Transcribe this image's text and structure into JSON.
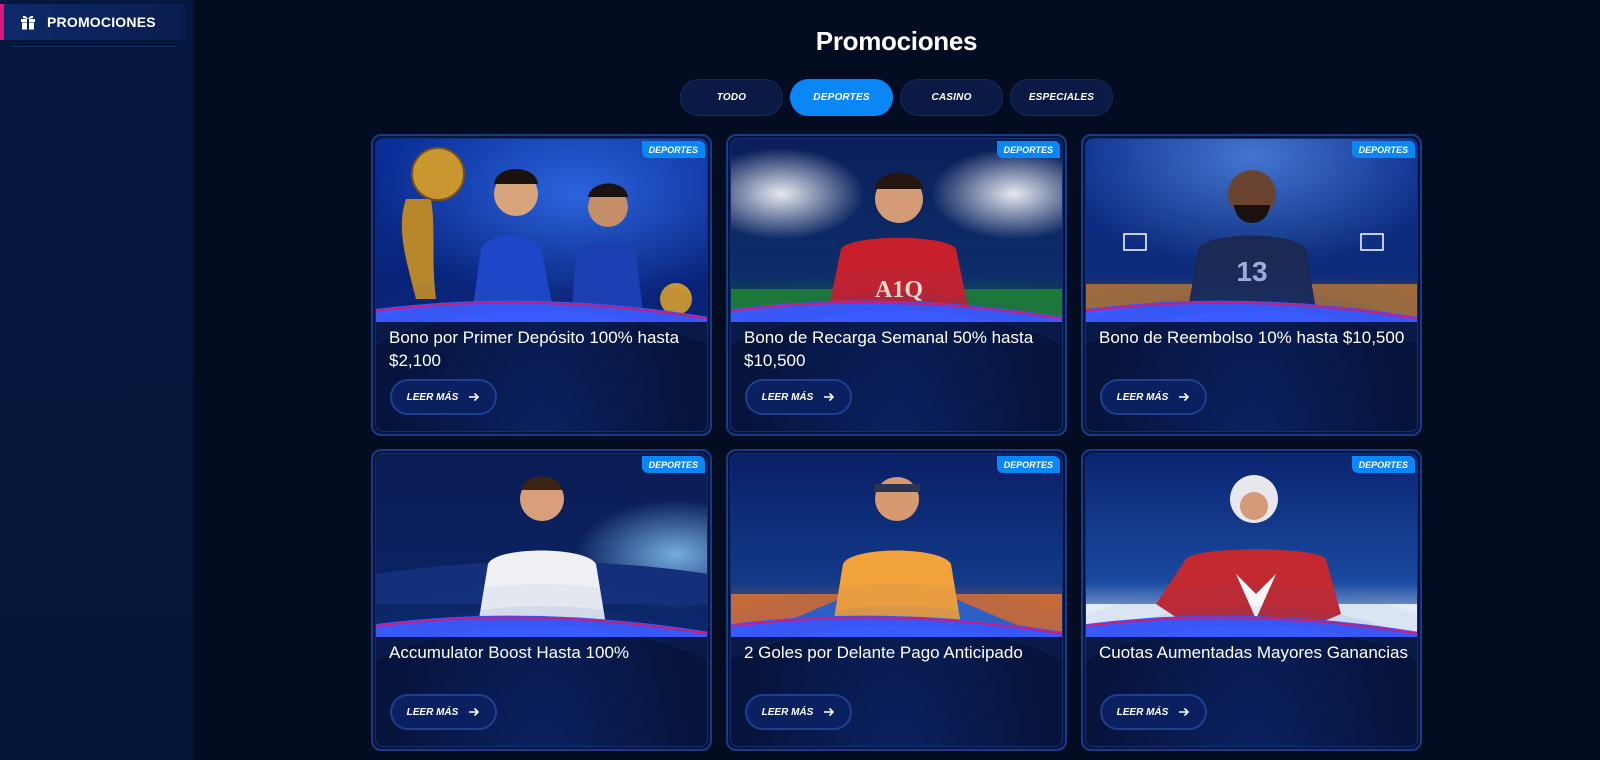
{
  "sidebar": {
    "items": [
      {
        "label": "PROMOCIONES",
        "icon": "gift-icon"
      }
    ]
  },
  "main": {
    "title": "Promociones",
    "tabs": [
      {
        "label": "TODO",
        "active": false
      },
      {
        "label": "DEPORTES",
        "active": true
      },
      {
        "label": "CASINO",
        "active": false
      },
      {
        "label": "ESPECIALES",
        "active": false
      }
    ],
    "cards": [
      {
        "badge": "DEPORTES",
        "title": "Bono por Primer Depósito 100% hasta $2,100",
        "button": "LEER MÁS",
        "image": "soccer-trophy-image"
      },
      {
        "badge": "DEPORTES",
        "title": "Bono de Recarga Semanal 50% hasta $10,500",
        "button": "LEER MÁS",
        "image": "soccer-goalkeeper-image"
      },
      {
        "badge": "DEPORTES",
        "title": "Bono de Reembolso 10% hasta $10,500",
        "button": "LEER MÁS",
        "image": "basketball-player-image"
      },
      {
        "badge": "DEPORTES",
        "title": "Accumulator Boost Hasta 100%",
        "button": "LEER MÁS",
        "image": "soccer-celebration-image"
      },
      {
        "badge": "DEPORTES",
        "title": "2 Goles por Delante Pago Anticipado",
        "button": "LEER MÁS",
        "image": "tennis-player-image"
      },
      {
        "badge": "DEPORTES",
        "title": "Cuotas Aumentadas Mayores Ganancias",
        "button": "LEER MÁS",
        "image": "hockey-player-image"
      }
    ]
  },
  "colors": {
    "background": "#040c22",
    "sidebar": "#06173f",
    "accent_blue": "#0b86f5",
    "accent_pink": "#e0167c",
    "card_border": "#1b3a86"
  }
}
